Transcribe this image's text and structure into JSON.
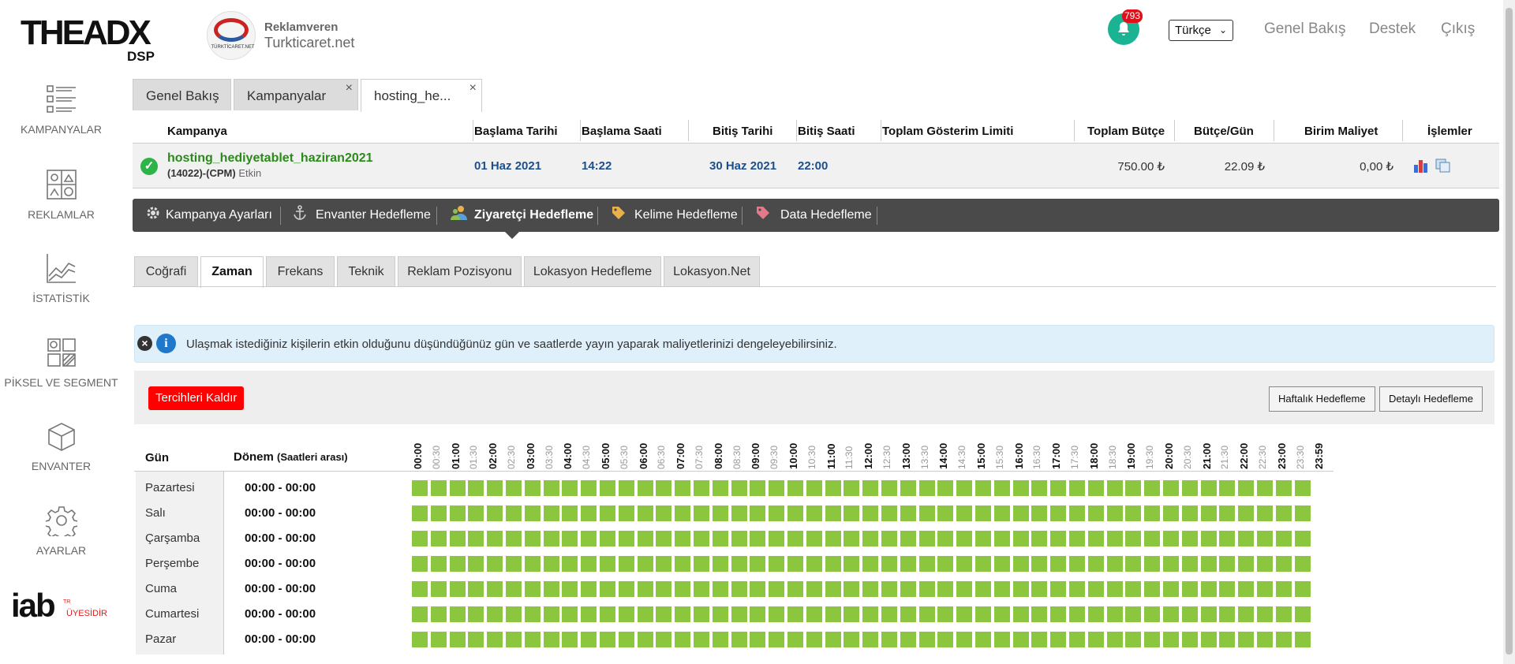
{
  "brand": {
    "logo_main": "THEADX",
    "logo_sub": "DSP"
  },
  "advertiser": {
    "logo_text": "TÜRKTİCARET.NET",
    "role": "Reklamveren",
    "name": "Turkticaret.net"
  },
  "header": {
    "notifications": "793",
    "language": "Türkçe",
    "links": [
      "Genel Bakış",
      "Destek",
      "Çıkış"
    ]
  },
  "sidebar": {
    "items": [
      {
        "label": "KAMPANYALAR",
        "icon": "list-icon"
      },
      {
        "label": "REKLAMLAR",
        "icon": "ads-grid-icon"
      },
      {
        "label": "İSTATİSTİK",
        "icon": "chart-icon"
      },
      {
        "label": "PİKSEL VE SEGMENT",
        "icon": "pixel-segment-icon"
      },
      {
        "label": "ENVANTER",
        "icon": "box-icon"
      },
      {
        "label": "AYARLAR",
        "icon": "gear-icon"
      }
    ],
    "iab": {
      "logo": "iab",
      "tr": "TR",
      "member": "ÜYESİDİR"
    }
  },
  "page_tabs": [
    {
      "label": "Genel Bakış",
      "closable": false
    },
    {
      "label": "Kampanyalar",
      "closable": true
    },
    {
      "label": "hosting_he...",
      "closable": true,
      "active": true
    }
  ],
  "campaign_table": {
    "headers": {
      "campaign": "Kampanya",
      "start_date": "Başlama Tarihi",
      "start_time": "Başlama Saati",
      "end_date": "Bitiş Tarihi",
      "end_time": "Bitiş Saati",
      "impression_limit": "Toplam Gösterim Limiti",
      "total_budget": "Toplam Bütçe",
      "daily_budget": "Bütçe/Gün",
      "unit_cost": "Birim Maliyet",
      "actions": "İşlemler"
    },
    "row": {
      "name": "hosting_hediyetablet_haziran2021",
      "id": "(14022)-(CPM)",
      "status": "Etkin",
      "start_date": "01 Haz 2021",
      "start_time": "14:22",
      "end_date": "30 Haz 2021",
      "end_time": "22:00",
      "impression_limit": "",
      "total_budget": "750.00 ₺",
      "daily_budget": "22.09 ₺",
      "unit_cost": "0,00 ₺"
    }
  },
  "settings_nav": [
    {
      "label": "Kampanya Ayarları",
      "icon": "gear-icon"
    },
    {
      "label": "Envanter Hedefleme",
      "icon": "anchor-icon"
    },
    {
      "label": "Ziyaretçi Hedefleme",
      "icon": "users-icon",
      "active": true
    },
    {
      "label": "Kelime Hedefleme",
      "icon": "tag-icon"
    },
    {
      "label": "Data Hedefleme",
      "icon": "tags-icon"
    }
  ],
  "sub_tabs": [
    "Coğrafi",
    "Zaman",
    "Frekans",
    "Teknik",
    "Reklam Pozisyonu",
    "Lokasyon Hedefleme",
    "Lokasyon.Net"
  ],
  "active_sub_tab": "Zaman",
  "info": {
    "text": "Ulaşmak istediğiniz kişilerin etkin olduğunu düşündüğünüz gün ve saatlerde yayın yaparak maliyetlerinizi dengeleyebilirsiniz."
  },
  "controls": {
    "reset": "Tercihleri Kaldır",
    "weekly": "Haftalık Hedefleme",
    "detailed": "Detaylı Hedefleme"
  },
  "schedule": {
    "col_day": "Gün",
    "col_period": "Dönem",
    "col_period_note": "(Saatleri arası)",
    "hours": [
      "00:00",
      "00:30",
      "01:00",
      "01:30",
      "02:00",
      "02:30",
      "03:00",
      "03:30",
      "04:00",
      "04:30",
      "05:00",
      "05:30",
      "06:00",
      "06:30",
      "07:00",
      "07:30",
      "08:00",
      "08:30",
      "09:00",
      "09:30",
      "10:00",
      "10:30",
      "11:00",
      "11:30",
      "12:00",
      "12:30",
      "13:00",
      "13:30",
      "14:00",
      "14:30",
      "15:00",
      "15:30",
      "16:00",
      "16:30",
      "17:00",
      "17:30",
      "18:00",
      "18:30",
      "19:00",
      "19:30",
      "20:00",
      "20:30",
      "21:00",
      "21:30",
      "22:00",
      "22:30",
      "23:00",
      "23:30",
      "23:59"
    ],
    "days": [
      {
        "name": "Pazartesi",
        "range": "00:00 - 00:00"
      },
      {
        "name": "Salı",
        "range": "00:00 - 00:00"
      },
      {
        "name": "Çarşamba",
        "range": "00:00 - 00:00"
      },
      {
        "name": "Perşembe",
        "range": "00:00 - 00:00"
      },
      {
        "name": "Cuma",
        "range": "00:00 - 00:00"
      },
      {
        "name": "Cumartesi",
        "range": "00:00 - 00:00"
      },
      {
        "name": "Pazar",
        "range": "00:00 - 00:00"
      }
    ],
    "cell_color": "#8cc63f"
  },
  "colors": {
    "accent": "#1ab394",
    "danger": "#ff0000",
    "campaign_name": "#2a8a1a",
    "dark_nav": "#4a4a4a"
  }
}
